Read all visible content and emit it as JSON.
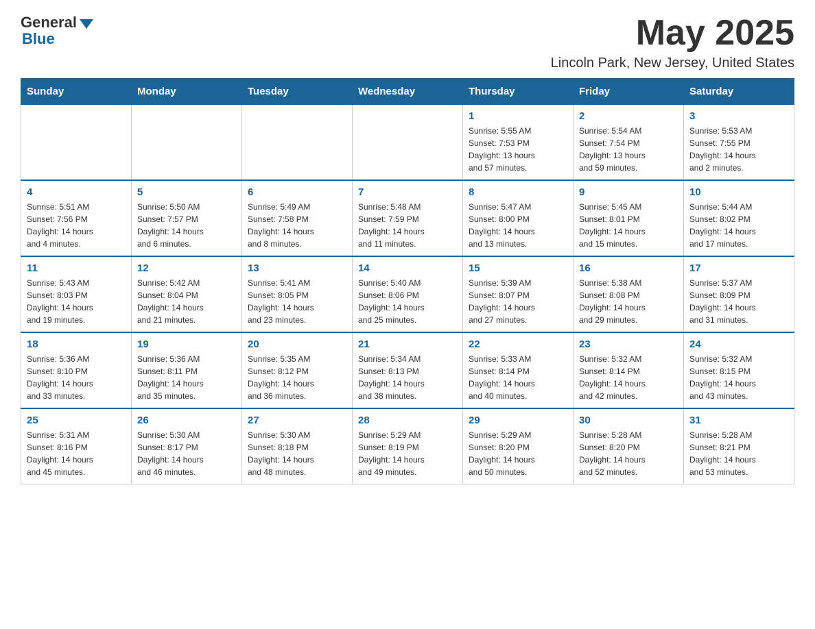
{
  "header": {
    "logo_general": "General",
    "logo_blue": "Blue",
    "month_title": "May 2025",
    "location": "Lincoln Park, New Jersey, United States"
  },
  "days_of_week": [
    "Sunday",
    "Monday",
    "Tuesday",
    "Wednesday",
    "Thursday",
    "Friday",
    "Saturday"
  ],
  "weeks": [
    [
      {
        "day": "",
        "info": ""
      },
      {
        "day": "",
        "info": ""
      },
      {
        "day": "",
        "info": ""
      },
      {
        "day": "",
        "info": ""
      },
      {
        "day": "1",
        "info": "Sunrise: 5:55 AM\nSunset: 7:53 PM\nDaylight: 13 hours\nand 57 minutes."
      },
      {
        "day": "2",
        "info": "Sunrise: 5:54 AM\nSunset: 7:54 PM\nDaylight: 13 hours\nand 59 minutes."
      },
      {
        "day": "3",
        "info": "Sunrise: 5:53 AM\nSunset: 7:55 PM\nDaylight: 14 hours\nand 2 minutes."
      }
    ],
    [
      {
        "day": "4",
        "info": "Sunrise: 5:51 AM\nSunset: 7:56 PM\nDaylight: 14 hours\nand 4 minutes."
      },
      {
        "day": "5",
        "info": "Sunrise: 5:50 AM\nSunset: 7:57 PM\nDaylight: 14 hours\nand 6 minutes."
      },
      {
        "day": "6",
        "info": "Sunrise: 5:49 AM\nSunset: 7:58 PM\nDaylight: 14 hours\nand 8 minutes."
      },
      {
        "day": "7",
        "info": "Sunrise: 5:48 AM\nSunset: 7:59 PM\nDaylight: 14 hours\nand 11 minutes."
      },
      {
        "day": "8",
        "info": "Sunrise: 5:47 AM\nSunset: 8:00 PM\nDaylight: 14 hours\nand 13 minutes."
      },
      {
        "day": "9",
        "info": "Sunrise: 5:45 AM\nSunset: 8:01 PM\nDaylight: 14 hours\nand 15 minutes."
      },
      {
        "day": "10",
        "info": "Sunrise: 5:44 AM\nSunset: 8:02 PM\nDaylight: 14 hours\nand 17 minutes."
      }
    ],
    [
      {
        "day": "11",
        "info": "Sunrise: 5:43 AM\nSunset: 8:03 PM\nDaylight: 14 hours\nand 19 minutes."
      },
      {
        "day": "12",
        "info": "Sunrise: 5:42 AM\nSunset: 8:04 PM\nDaylight: 14 hours\nand 21 minutes."
      },
      {
        "day": "13",
        "info": "Sunrise: 5:41 AM\nSunset: 8:05 PM\nDaylight: 14 hours\nand 23 minutes."
      },
      {
        "day": "14",
        "info": "Sunrise: 5:40 AM\nSunset: 8:06 PM\nDaylight: 14 hours\nand 25 minutes."
      },
      {
        "day": "15",
        "info": "Sunrise: 5:39 AM\nSunset: 8:07 PM\nDaylight: 14 hours\nand 27 minutes."
      },
      {
        "day": "16",
        "info": "Sunrise: 5:38 AM\nSunset: 8:08 PM\nDaylight: 14 hours\nand 29 minutes."
      },
      {
        "day": "17",
        "info": "Sunrise: 5:37 AM\nSunset: 8:09 PM\nDaylight: 14 hours\nand 31 minutes."
      }
    ],
    [
      {
        "day": "18",
        "info": "Sunrise: 5:36 AM\nSunset: 8:10 PM\nDaylight: 14 hours\nand 33 minutes."
      },
      {
        "day": "19",
        "info": "Sunrise: 5:36 AM\nSunset: 8:11 PM\nDaylight: 14 hours\nand 35 minutes."
      },
      {
        "day": "20",
        "info": "Sunrise: 5:35 AM\nSunset: 8:12 PM\nDaylight: 14 hours\nand 36 minutes."
      },
      {
        "day": "21",
        "info": "Sunrise: 5:34 AM\nSunset: 8:13 PM\nDaylight: 14 hours\nand 38 minutes."
      },
      {
        "day": "22",
        "info": "Sunrise: 5:33 AM\nSunset: 8:14 PM\nDaylight: 14 hours\nand 40 minutes."
      },
      {
        "day": "23",
        "info": "Sunrise: 5:32 AM\nSunset: 8:14 PM\nDaylight: 14 hours\nand 42 minutes."
      },
      {
        "day": "24",
        "info": "Sunrise: 5:32 AM\nSunset: 8:15 PM\nDaylight: 14 hours\nand 43 minutes."
      }
    ],
    [
      {
        "day": "25",
        "info": "Sunrise: 5:31 AM\nSunset: 8:16 PM\nDaylight: 14 hours\nand 45 minutes."
      },
      {
        "day": "26",
        "info": "Sunrise: 5:30 AM\nSunset: 8:17 PM\nDaylight: 14 hours\nand 46 minutes."
      },
      {
        "day": "27",
        "info": "Sunrise: 5:30 AM\nSunset: 8:18 PM\nDaylight: 14 hours\nand 48 minutes."
      },
      {
        "day": "28",
        "info": "Sunrise: 5:29 AM\nSunset: 8:19 PM\nDaylight: 14 hours\nand 49 minutes."
      },
      {
        "day": "29",
        "info": "Sunrise: 5:29 AM\nSunset: 8:20 PM\nDaylight: 14 hours\nand 50 minutes."
      },
      {
        "day": "30",
        "info": "Sunrise: 5:28 AM\nSunset: 8:20 PM\nDaylight: 14 hours\nand 52 minutes."
      },
      {
        "day": "31",
        "info": "Sunrise: 5:28 AM\nSunset: 8:21 PM\nDaylight: 14 hours\nand 53 minutes."
      }
    ]
  ]
}
